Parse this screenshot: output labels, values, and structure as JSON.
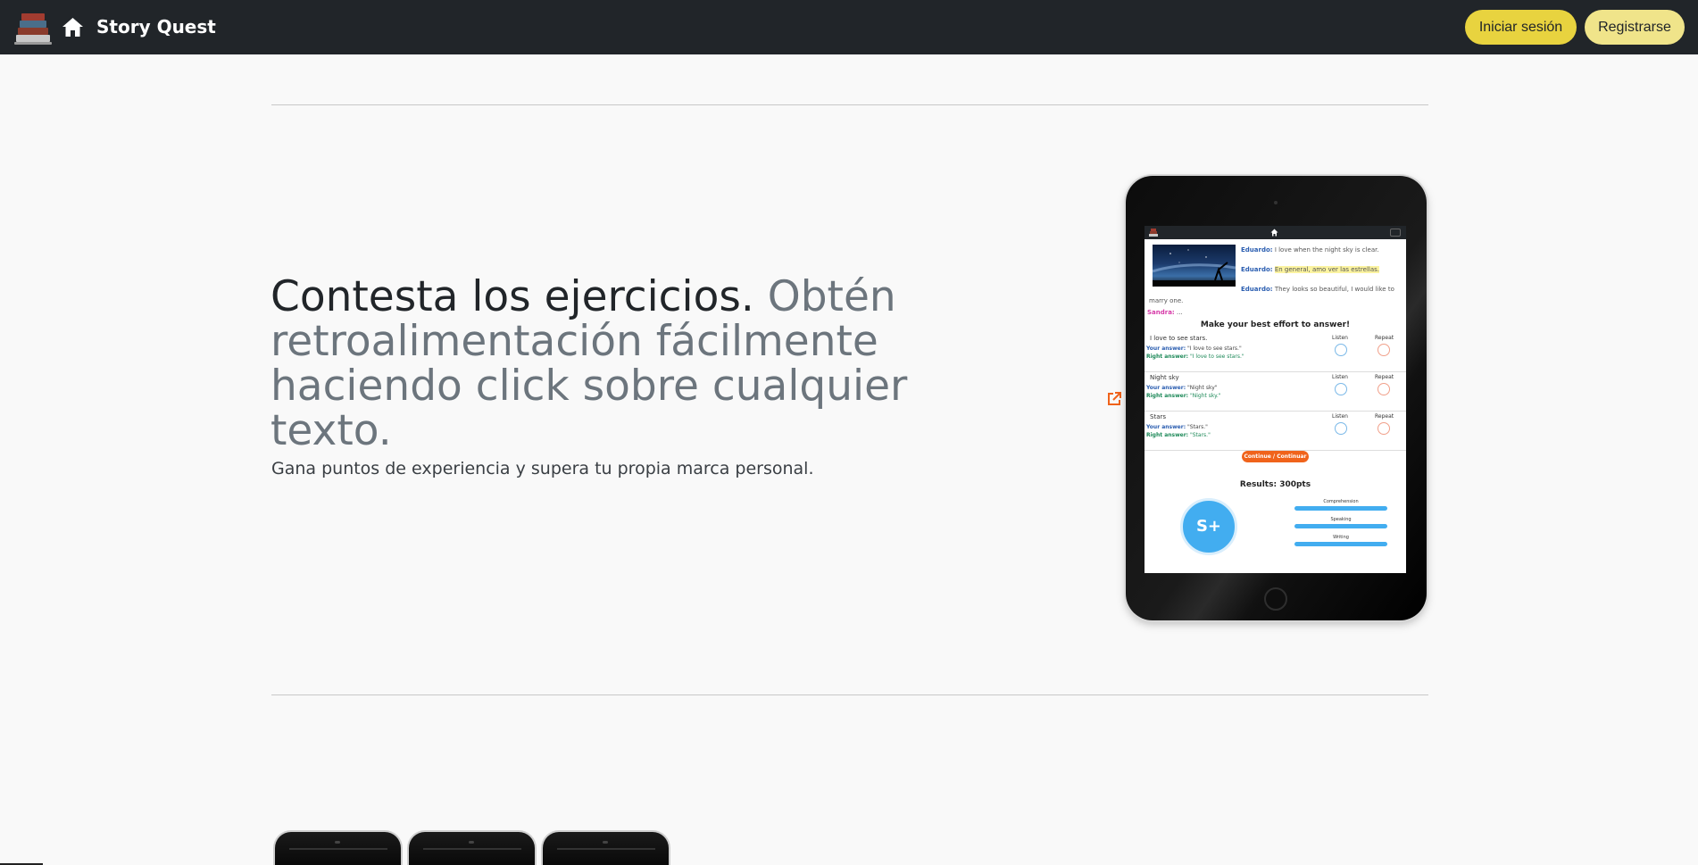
{
  "navbar": {
    "brand": "Story Quest",
    "login_label": "Iniciar sesión",
    "register_label": "Registrarse",
    "icons": [
      "books-logo-icon",
      "home-icon"
    ],
    "colors": {
      "background": "#212529",
      "login": "#e8d33f",
      "register": "#f0e48a"
    }
  },
  "hero": {
    "title_dark": "Contesta los ejercicios.",
    "title_muted": "Obtén retroalimentación fácilmente haciendo click sobre cualquier texto.",
    "subtitle": "Gana puntos de experiencia y supera tu propia marca personal.",
    "external_link_icon": "external-link-icon"
  },
  "tablet_preview": {
    "story": {
      "line1_name": "Eduardo:",
      "line1_text": "I love when the night sky is clear.",
      "line2_name": "Eduardo:",
      "line2_text": "En general, amo ver las estrellas.",
      "line3_name": "Eduardo:",
      "line3_text": "They looks so beautiful, I would like to",
      "line3_cont": "marry one.",
      "line4_name": "Sandra:",
      "line4_text": "..."
    },
    "exercise_heading": "Make your best effort to answer!",
    "listen_label": "Listen",
    "repeat_label": "Repeat",
    "your_answer_label": "Your answer:",
    "right_answer_label": "Right answer:",
    "exercises": [
      {
        "prompt": "I love to see stars.",
        "your_answer": "\"I love to see stars.\"",
        "right_answer": "\"I love to see stars.\""
      },
      {
        "prompt": "Night sky",
        "your_answer": "\"Night sky\"",
        "right_answer": "\"Night sky.\""
      },
      {
        "prompt": "Stars",
        "your_answer": "\"Stars.\"",
        "right_answer": "\"Stars.\""
      }
    ],
    "continue_label": "Continue / Continuar",
    "results_label": "Results:",
    "results_points": "300pts",
    "grade": "S+",
    "skills": [
      "Comprehension",
      "Speaking",
      "Writing"
    ],
    "skill_levels": [
      1.0,
      1.0,
      1.0
    ]
  }
}
